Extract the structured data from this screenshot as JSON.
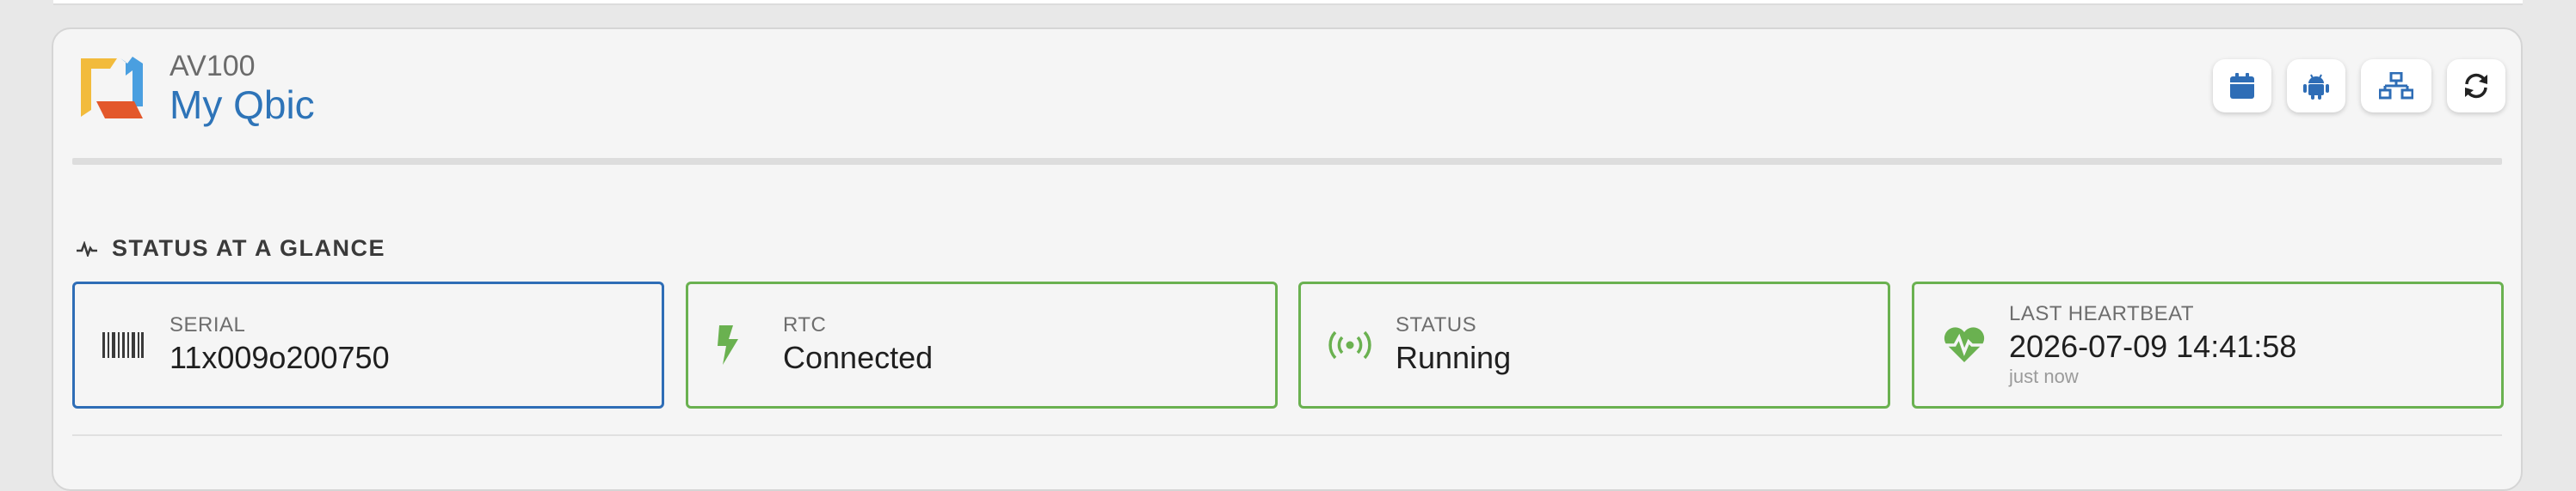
{
  "device": {
    "model": "AV100",
    "name": "My Qbic"
  },
  "toolbar": {
    "buttons": [
      {
        "icon": "calendar-icon"
      },
      {
        "icon": "android-icon"
      },
      {
        "icon": "network-icon"
      },
      {
        "icon": "refresh-icon"
      }
    ]
  },
  "section": {
    "title": "STATUS AT A GLANCE",
    "icon": "pulse-icon"
  },
  "cards": {
    "serial": {
      "label": "SERIAL",
      "value": "11x009o200750",
      "icon": "barcode-icon"
    },
    "rtc": {
      "label": "RTC",
      "value": "Connected",
      "icon": "bolt-icon"
    },
    "status": {
      "label": "STATUS",
      "value": "Running",
      "icon": "broadcast-icon"
    },
    "heartbeat": {
      "label": "LAST HEARTBEAT",
      "value": "2026-07-09 14:41:58",
      "sub": "just now",
      "icon": "heartbeat-icon"
    }
  },
  "colors": {
    "accent": "#2e74b8",
    "ok_green": "#6ab150",
    "logo_yellow": "#f2bb3c",
    "logo_blue": "#4a9fe0",
    "logo_red": "#e3582b"
  }
}
